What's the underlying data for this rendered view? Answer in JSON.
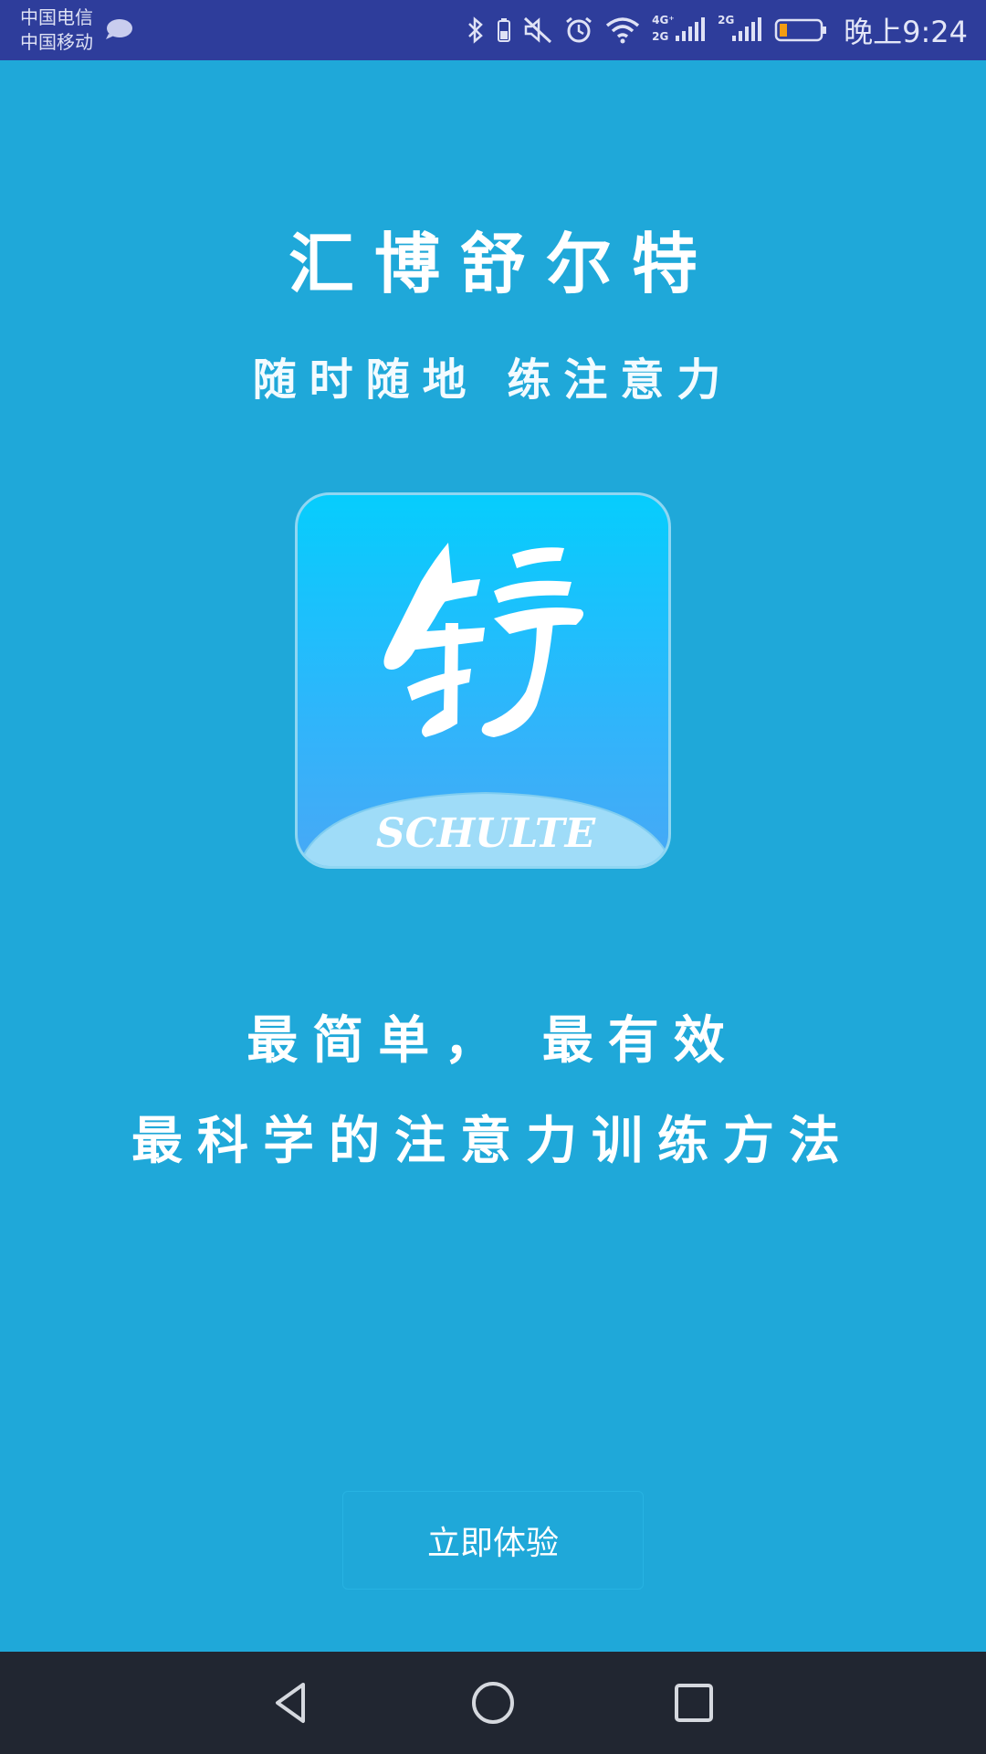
{
  "status_bar": {
    "carrier_1": "中国电信",
    "carrier_2": "中国移动",
    "network_label_1": "4G⁺",
    "network_label_2": "2G",
    "network_label_3": "2G",
    "time": "晚上9:24"
  },
  "splash": {
    "app_title": "汇博舒尔特",
    "subtitle": "随时随地  练注意力",
    "logo_text": "SCHULTE",
    "tagline_1": "最简单，  最有效",
    "tagline_2": "最科学的注意力训练方法",
    "start_button": "立即体验"
  },
  "colors": {
    "background": "#1fa8d9",
    "status_bar": "#2e3d9b",
    "nav_bar": "#212631",
    "logo_top": "#06cdfd",
    "logo_bottom": "#48a8f6"
  },
  "icons": [
    "message-icon",
    "bluetooth-icon",
    "battery-small-icon",
    "mute-icon",
    "alarm-icon",
    "wifi-icon",
    "signal-icon",
    "battery-icon",
    "back-icon",
    "home-icon",
    "recents-icon"
  ]
}
